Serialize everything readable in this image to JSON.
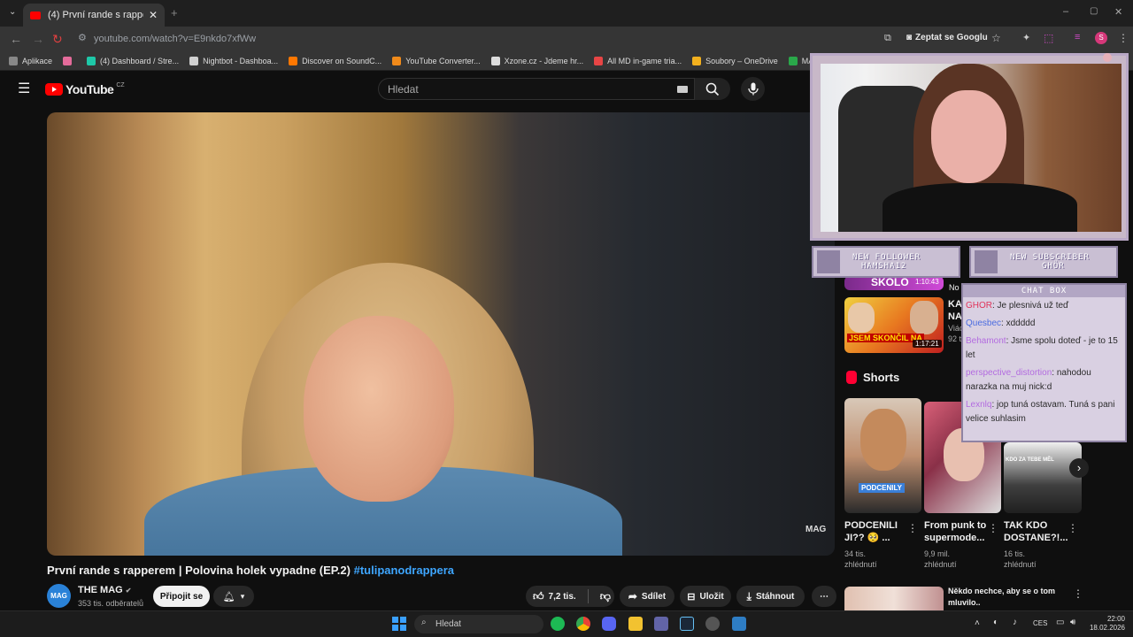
{
  "browser": {
    "tab_title": "(4) První rande s rapperem | Po",
    "url": "youtube.com/watch?v=E9nkdo7xfWw",
    "toolbar_ask_google": "Zeptat se Googlu",
    "bookmarks": [
      {
        "label": "Aplikace",
        "color": "#888888"
      },
      {
        "label": "",
        "color": "#e46b9a"
      },
      {
        "label": "(4) Dashboard / Stre...",
        "color": "#1ec8a8"
      },
      {
        "label": "Nightbot - Dashboa...",
        "color": "#d0d0d0"
      },
      {
        "label": "Discover on SoundC...",
        "color": "#ff7700"
      },
      {
        "label": "YouTube Converter...",
        "color": "#f08a1a"
      },
      {
        "label": "Xzone.cz - Jdeme hr...",
        "color": "#dddddd"
      },
      {
        "label": "All MD in-game tria...",
        "color": "#e84545"
      },
      {
        "label": "Soubory – OneDrive",
        "color": "#f2b01e"
      },
      {
        "label": "MATURITA_OKRUH...",
        "color": "#2aa84a"
      }
    ]
  },
  "youtube": {
    "logo": "YouTube",
    "region": "CZ",
    "search_placeholder": "Hledat",
    "video": {
      "watermark": "MAG",
      "title": "První rande s rapperem | Polovina holek vypadne (EP.2)",
      "hashtag": "#tulipanodrappera"
    },
    "channel": {
      "avatar_text": "MAG",
      "name": "THE MAG",
      "subs": "353 tis. odběratelů",
      "join_label": "Připojit se"
    },
    "actions": {
      "likes": "7,2 tis.",
      "share": "Sdílet",
      "save": "Uložit",
      "download": "Stáhnout"
    },
    "sidebar": {
      "top_video_title_fragment": "KA\nNA",
      "top_video_channel_fragment": "Viác",
      "top_video_stats_fragment": "92 t",
      "top_video_badge": "JSEM SKONČIL NA",
      "top_video_duration": "1:17:21",
      "prev_thumb_text": "SKOLO",
      "prev_thumb_duration": "1:10:43",
      "prev_title_fragment": "No",
      "shorts_label": "Shorts",
      "shorts": [
        {
          "title": "PODCENILI JI?? 🥺 ...",
          "views": "34 tis.",
          "suffix": "zhlédnutí",
          "overlay": "PODCENILY"
        },
        {
          "title": "From punk to supermode...",
          "views": "9,9 mil.",
          "suffix": "zhlédnutí",
          "overlay": ""
        },
        {
          "title": "TAK KDO DOSTANE?!...",
          "views": "16 tis.",
          "suffix": "zhlédnutí",
          "overlay": "KDO ZA TEBE MĚL"
        }
      ],
      "next_video_title": "Někdo nechce, aby se o tom mluvilo.."
    }
  },
  "overlay": {
    "follower_label": "NEW FOLLOWER",
    "follower_name": "HAMSHA12",
    "subscriber_label": "NEW SUBSCRIBER",
    "subscriber_name": "GHÖR",
    "chat_title": "CHAT BOX",
    "messages": [
      {
        "user": "GHOR",
        "user_color": "#e0335a",
        "text": ": Je plesnivá už teď"
      },
      {
        "user": "Quesbec",
        "user_color": "#4a6be0",
        "text": ": xddddd"
      },
      {
        "user": "Behamont",
        "user_color": "#b36be0",
        "text": ": Jsme spolu doteď - je to 15 let"
      },
      {
        "user": "perspective_distortion",
        "user_color": "#b36be0",
        "text": ": nahodou narazka na muj nick:d"
      },
      {
        "user": "Lexnlq",
        "user_color": "#b36be0",
        "text": ": jop tuná ostavam. Tuná s pani velice suhlasim"
      }
    ]
  },
  "taskbar": {
    "search_placeholder": "Hledat",
    "language": "CES",
    "time": "22:00",
    "date": "18.02.2026"
  }
}
